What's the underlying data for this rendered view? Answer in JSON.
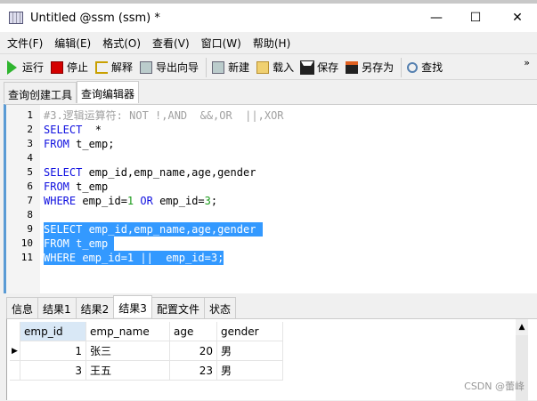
{
  "window": {
    "title": "Untitled @ssm (ssm) *",
    "minimize": "—",
    "maximize": "☐",
    "close": "✕"
  },
  "menu": [
    "文件(F)",
    "编辑(E)",
    "格式(O)",
    "查看(V)",
    "窗口(W)",
    "帮助(H)"
  ],
  "toolbar": {
    "run": "运行",
    "stop": "停止",
    "explain": "解释",
    "export": "导出向导",
    "new": "新建",
    "load": "载入",
    "save": "保存",
    "save_as": "另存为",
    "find": "查找",
    "more": "»"
  },
  "tabs": [
    "查询创建工具",
    "查询编辑器"
  ],
  "editor": {
    "lines": [
      [
        [
          "cm",
          "#3.逻辑运算符: NOT !,AND  &&,OR  ||,XOR"
        ]
      ],
      [
        [
          "kw",
          "SELECT"
        ],
        [
          "",
          "  *"
        ]
      ],
      [
        [
          "kw",
          "FROM"
        ],
        [
          "",
          " t_emp;"
        ]
      ],
      [],
      [
        [
          "kw",
          "SELECT"
        ],
        [
          "",
          " emp_id,emp_name,age,gender"
        ]
      ],
      [
        [
          "kw",
          "FROM"
        ],
        [
          "",
          " t_emp"
        ]
      ],
      [
        [
          "kw",
          "WHERE"
        ],
        [
          "",
          " emp_id="
        ],
        [
          "num",
          "1"
        ],
        [
          "",
          ""
        ],
        [
          "kw",
          " OR"
        ],
        [
          "",
          " emp_id="
        ],
        [
          "num",
          "3"
        ],
        [
          "",
          ";"
        ]
      ],
      [],
      [
        [
          "kw",
          "SELECT"
        ],
        [
          "",
          " emp_id,emp_name,age,gender "
        ]
      ],
      [
        [
          "kw",
          "FROM"
        ],
        [
          "",
          " t_emp "
        ]
      ],
      [
        [
          "kw",
          "WHERE"
        ],
        [
          "",
          " emp_id=1 ||  emp_id=3;"
        ]
      ]
    ],
    "selected_lines": [
      9,
      10,
      11
    ]
  },
  "result_tabs": [
    "信息",
    "结果1",
    "结果2",
    "结果3",
    "配置文件",
    "状态"
  ],
  "grid": {
    "columns": [
      "emp_id",
      "emp_name",
      "age",
      "gender"
    ],
    "rows": [
      [
        "1",
        "张三",
        "20",
        "男"
      ],
      [
        "3",
        "王五",
        "23",
        "男"
      ]
    ]
  },
  "watermark": "CSDN @蕾峰"
}
